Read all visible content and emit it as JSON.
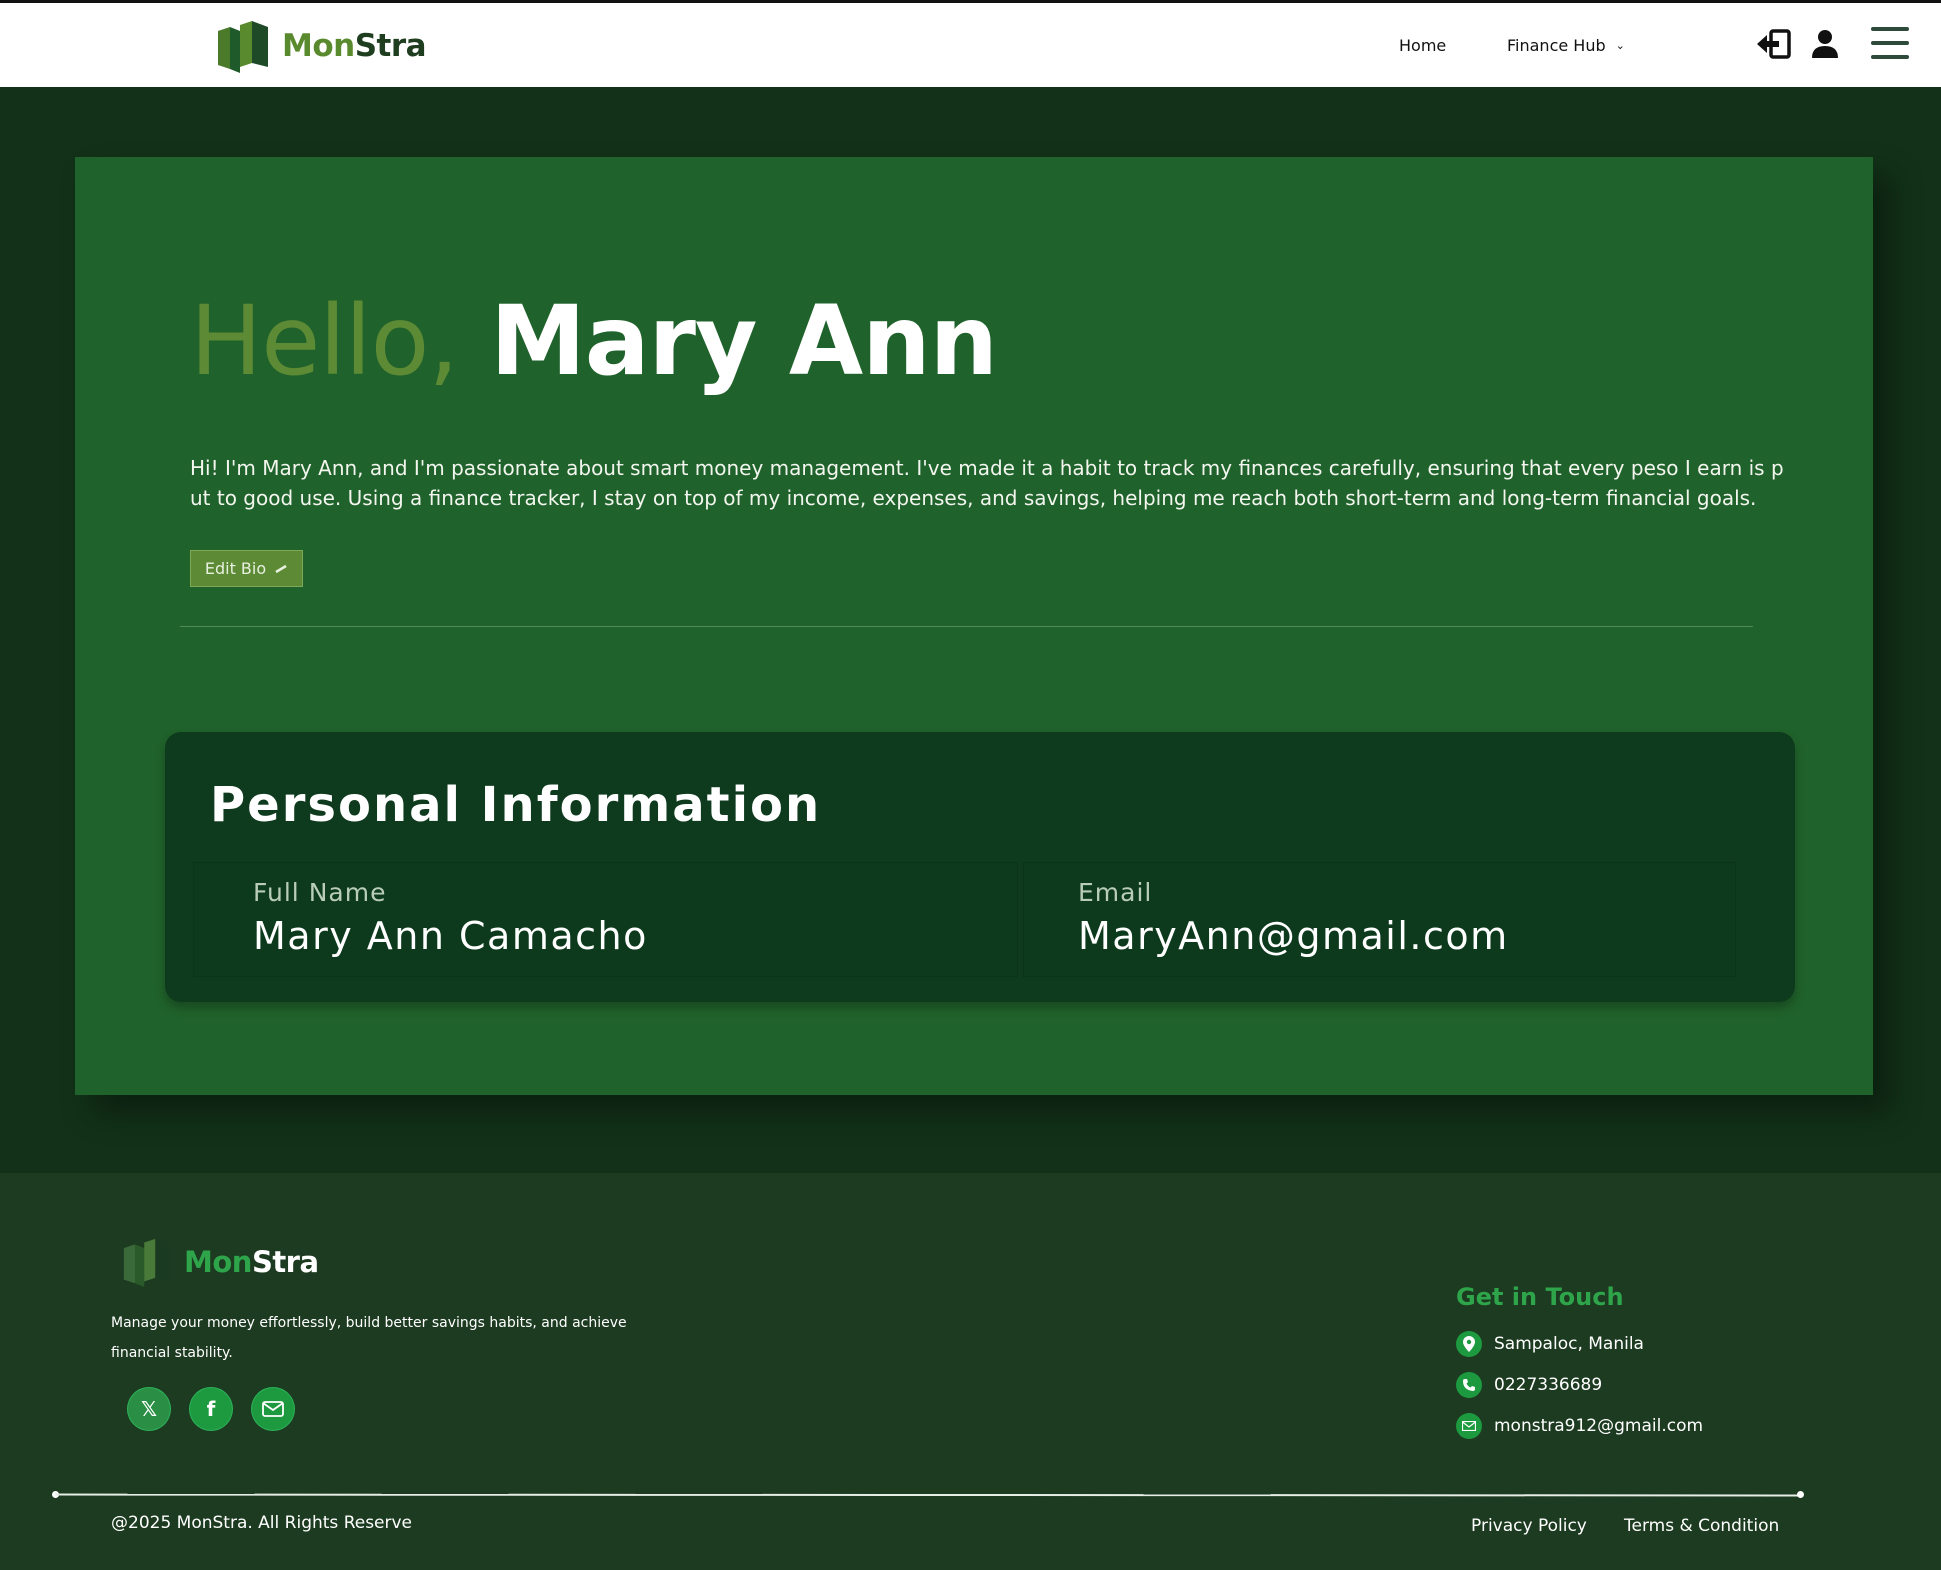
{
  "colors": {
    "brand_green": "#5d8a35",
    "dark_green": "#123118",
    "card_green": "#20622b",
    "footer_green": "#1c3b20",
    "accent_green": "#2fa54b"
  },
  "header": {
    "logo": {
      "part1": "Mon",
      "part2": "Stra",
      "icon": "monstra-logo-icon"
    },
    "nav": {
      "home": "Home",
      "finance_hub": "Finance Hub"
    },
    "icons": [
      "logout-icon",
      "user-icon",
      "menu-icon"
    ]
  },
  "profile": {
    "greeting": "Hello,",
    "name": "Mary Ann",
    "bio": "Hi! I'm Mary Ann, and I'm passionate about smart money management. I've made it a habit to track my finances carefully, ensuring that every peso I earn is put to good use. Using a finance tracker, I stay on top of my income, expenses, and savings, helping me reach both short-term and long-term financial goals.",
    "edit_bio_label": "Edit Bio"
  },
  "personal_info": {
    "title": "Personal Information",
    "full_name_label": "Full Name",
    "full_name_value": "Mary Ann Camacho",
    "email_label": "Email",
    "email_value": "MaryAnn@gmail.com"
  },
  "footer": {
    "logo": {
      "part1": "Mon",
      "part2": "Stra"
    },
    "description": "Manage your money effortlessly, build better savings habits, and achieve financial stability.",
    "socials": [
      "x-icon",
      "facebook-icon",
      "mail-icon"
    ],
    "get_in_touch": {
      "title": "Get in Touch",
      "location": "Sampaloc, Manila",
      "phone": "0227336689",
      "email": "monstra912@gmail.com"
    },
    "copyright": "@2025 MonStra. All Rights Reserve",
    "privacy_policy": "Privacy Policy",
    "terms": "Terms & Condition"
  }
}
